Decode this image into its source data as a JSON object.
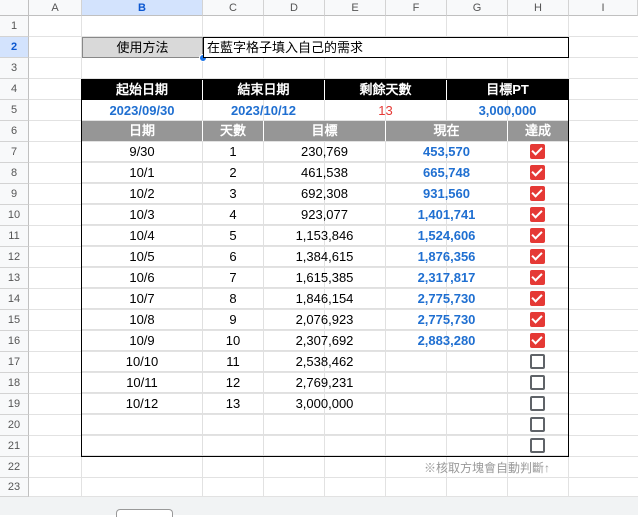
{
  "columns": [
    "A",
    "B",
    "C",
    "D",
    "E",
    "F",
    "G",
    "H",
    "I"
  ],
  "rows": [
    "1",
    "2",
    "3",
    "4",
    "5",
    "6",
    "7",
    "8",
    "9",
    "10",
    "11",
    "12",
    "13",
    "14",
    "15",
    "16",
    "17",
    "18",
    "19",
    "20",
    "21",
    "22",
    "23"
  ],
  "instructions": {
    "button_label": "使用方法",
    "note": "在藍字格子填入自己的需求"
  },
  "summary": {
    "headers": [
      "起始日期",
      "結束日期",
      "剩餘天數",
      "目標PT"
    ],
    "start_date": "2023/09/30",
    "end_date": "2023/10/12",
    "remaining_days": "13",
    "target_pt": "3,000,000"
  },
  "table": {
    "headers": [
      "日期",
      "天數",
      "目標",
      "現在",
      "達成"
    ],
    "rows": [
      {
        "date": "9/30",
        "day": "1",
        "target": "230,769",
        "current": "453,570",
        "done": true
      },
      {
        "date": "10/1",
        "day": "2",
        "target": "461,538",
        "current": "665,748",
        "done": true
      },
      {
        "date": "10/2",
        "day": "3",
        "target": "692,308",
        "current": "931,560",
        "done": true
      },
      {
        "date": "10/3",
        "day": "4",
        "target": "923,077",
        "current": "1,401,741",
        "done": true
      },
      {
        "date": "10/4",
        "day": "5",
        "target": "1,153,846",
        "current": "1,524,606",
        "done": true
      },
      {
        "date": "10/5",
        "day": "6",
        "target": "1,384,615",
        "current": "1,876,356",
        "done": true
      },
      {
        "date": "10/6",
        "day": "7",
        "target": "1,615,385",
        "current": "2,317,817",
        "done": true
      },
      {
        "date": "10/7",
        "day": "8",
        "target": "1,846,154",
        "current": "2,775,730",
        "done": true
      },
      {
        "date": "10/8",
        "day": "9",
        "target": "2,076,923",
        "current": "2,775,730",
        "done": true
      },
      {
        "date": "10/9",
        "day": "10",
        "target": "2,307,692",
        "current": "2,883,280",
        "done": true
      },
      {
        "date": "10/10",
        "day": "11",
        "target": "2,538,462",
        "current": "",
        "done": false
      },
      {
        "date": "10/11",
        "day": "12",
        "target": "2,769,231",
        "current": "",
        "done": false
      },
      {
        "date": "10/12",
        "day": "13",
        "target": "3,000,000",
        "current": "",
        "done": false
      },
      {
        "date": "",
        "day": "",
        "target": "",
        "current": "",
        "done": false
      },
      {
        "date": "",
        "day": "",
        "target": "",
        "current": "",
        "done": false
      }
    ]
  },
  "footnote": "※核取方塊會自動判斷↑",
  "colors": {
    "header_black": "#000000",
    "header_gray": "#969696",
    "value_blue": "#1f6fd1",
    "remaining_red": "#e53935",
    "checkbox_on": "#e53935"
  }
}
